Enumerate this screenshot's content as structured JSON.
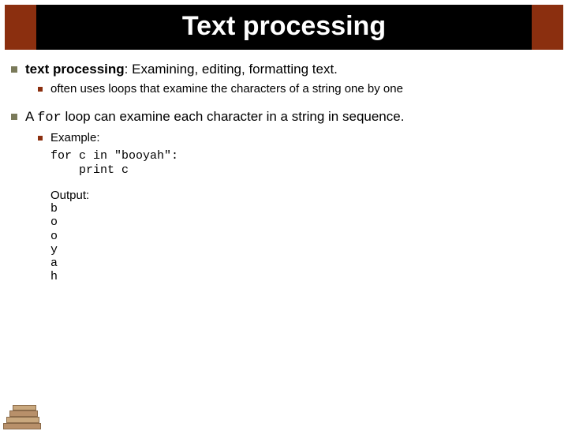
{
  "title": "Text processing",
  "bullets": [
    {
      "term": "text processing",
      "definition": ": Examining, editing, formatting text.",
      "sub": [
        "often uses loops that examine the characters of a string one by one"
      ]
    },
    {
      "prefix": "A ",
      "code_word": "for",
      "suffix": " loop can examine each character in a string in sequence.",
      "sub": [
        "Example:"
      ]
    }
  ],
  "code": "for c in \"booyah\":\n    print c",
  "output_label": "Output:",
  "output": "b\no\no\ny\na\nh"
}
